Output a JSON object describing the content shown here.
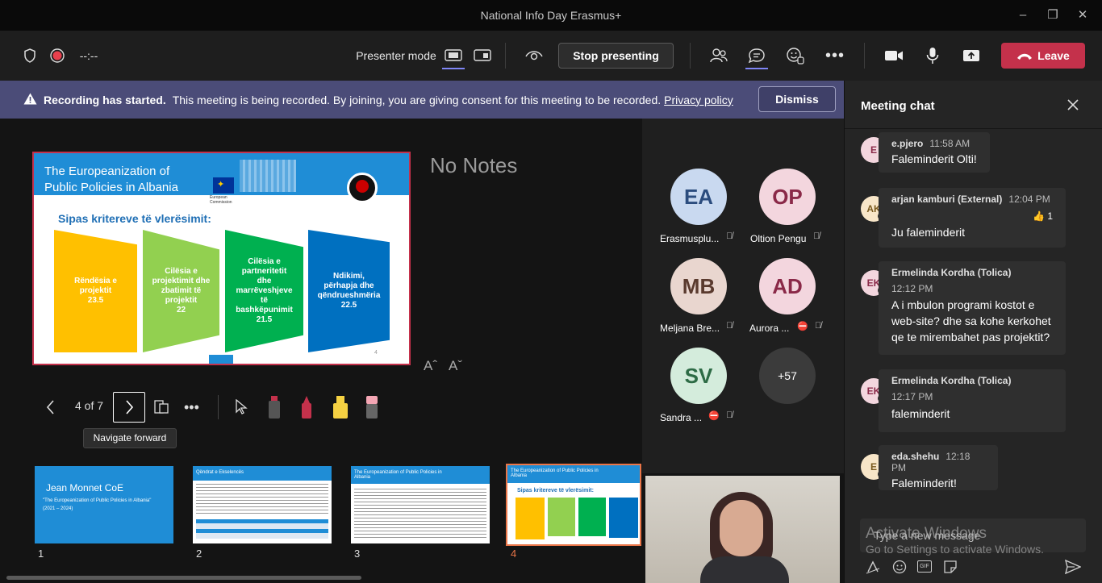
{
  "window": {
    "title": "National Info Day Erasmus+"
  },
  "toolbar": {
    "timer": "--:--",
    "presenter_mode_label": "Presenter mode",
    "stop_presenting": "Stop presenting",
    "leave": "Leave"
  },
  "banner": {
    "bold": "Recording has started.",
    "text": "This meeting is being recorded. By joining, you are giving consent for this meeting to be recorded.",
    "link": "Privacy policy",
    "dismiss": "Dismiss"
  },
  "slide": {
    "title_line1": "The Europeanization of",
    "title_line2": "Public Policies in Albania",
    "logo_text": "European Commission",
    "subtitle": "Sipas kritereve të vlerësimit:",
    "page_number": "4",
    "criteria": [
      {
        "line1": "Rëndësia e",
        "line2": "projektit",
        "line3": "",
        "line4": "",
        "score": "23.5",
        "color": "#ffc000"
      },
      {
        "line1": "Cilësia e",
        "line2": "projektimit dhe",
        "line3": "zbatimit të",
        "line4": "projektit",
        "score": "22",
        "color": "#92d050"
      },
      {
        "line1": "Cilësia e",
        "line2": "partneritetit",
        "line3": "dhe",
        "line4": "marrëveshjeve të bashkëpunimit",
        "score": "21.5",
        "color": "#00b050"
      },
      {
        "line1": "Ndikimi,",
        "line2": "përhapja dhe",
        "line3": "qëndrueshmëria",
        "line4": "",
        "score": "22.5",
        "color": "#0070c0"
      }
    ]
  },
  "notes": {
    "text": "No Notes",
    "font_up": "Aˆ",
    "font_down": "Aˇ"
  },
  "navigation": {
    "counter": "4 of 7",
    "tooltip": "Navigate forward"
  },
  "thumbnails": [
    {
      "num": "1",
      "title": "Jean Monnet CoE",
      "subtitle": "\"The Europeanization of Public Policies in Albania\"",
      "years": "(2021 – 2024)"
    },
    {
      "num": "2",
      "title": "Qëndrat e Ekselencës"
    },
    {
      "num": "3",
      "title": "The Europeanization of Public Policies in Albania"
    },
    {
      "num": "4",
      "title": "The Europeanization of Public Policies in Albania",
      "subtitle": "Sipas kritereve të vlerësimit:"
    }
  ],
  "participants": [
    {
      "initials": "EA",
      "name": "Erasmusplu...",
      "bg": "#c9d9f0",
      "fg": "#2b4c7e"
    },
    {
      "initials": "OP",
      "name": "Oltion Pengu",
      "bg": "#f3d6de",
      "fg": "#8a2948"
    },
    {
      "initials": "MB",
      "name": "Meljana Bre...",
      "bg": "#e9d6cf",
      "fg": "#5a3a2e"
    },
    {
      "initials": "AD",
      "name": "Aurora ...",
      "bg": "#f3d6de",
      "fg": "#8a2948"
    },
    {
      "initials": "SV",
      "name": "Sandra ...",
      "bg": "#d4ecdc",
      "fg": "#2d6b45"
    },
    {
      "initials": "+57",
      "name": "",
      "bg": "#3b3b3b",
      "fg": "#ffffff"
    }
  ],
  "chat": {
    "title": "Meeting chat",
    "messages": [
      {
        "initials": "E",
        "author": "e.pjero",
        "time": "11:58 AM",
        "text": "Faleminderit Olti!",
        "avbg": "#f3d6de",
        "avfg": "#8a2948",
        "status": "#999999"
      },
      {
        "initials": "AK",
        "author": "arjan kamburi (External)",
        "time": "12:04 PM",
        "text": "Ju faleminderit",
        "reaction": "👍 1",
        "avbg": "#f8e6c8",
        "avfg": "#7a5a1e",
        "status": "#e0a030"
      },
      {
        "initials": "EK",
        "author": "Ermelinda Kordha (Tolica)",
        "time": "12:12 PM",
        "text": "A i mbulon programi kostot e web-site? dhe sa kohe kerkohet qe te mirembahet pas projektit?",
        "avbg": "#f3d6de",
        "avfg": "#8a2948",
        "status": "#c4314b"
      },
      {
        "initials": "EK",
        "author": "Ermelinda Kordha (Tolica)",
        "time": "12:17 PM",
        "text": "faleminderit",
        "avbg": "#f3d6de",
        "avfg": "#8a2948",
        "status": "#c4314b"
      },
      {
        "initials": "E",
        "author": "eda.shehu",
        "time": "12:18 PM",
        "text": "Faleminderit!",
        "avbg": "#f8e6c8",
        "avfg": "#7a5a1e",
        "status": "#6bb700"
      }
    ],
    "input_placeholder": "Type a new message",
    "watermark_line1": "Activate Windows",
    "watermark_line2": "Go to Settings to activate Windows."
  },
  "colors": {
    "accent": "#6264a7",
    "danger": "#c4314b",
    "banner": "#4b4c78"
  }
}
